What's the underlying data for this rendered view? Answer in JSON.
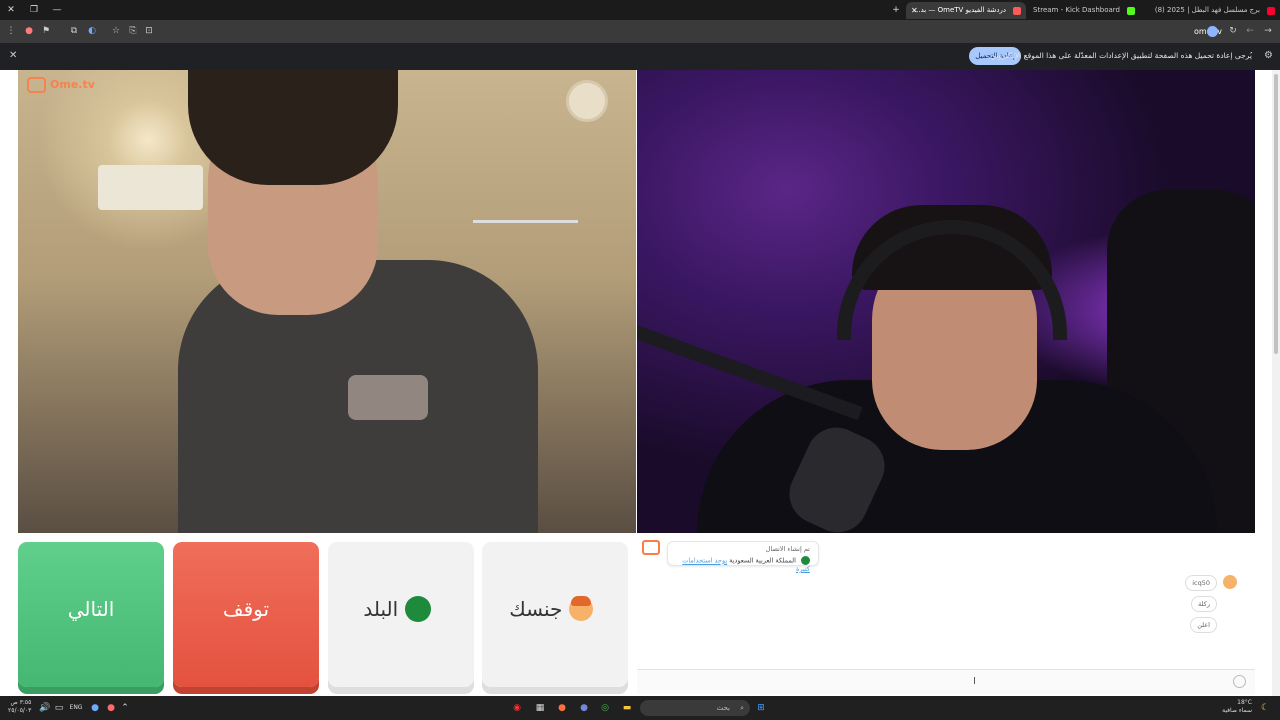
{
  "browser": {
    "tabs": [
      {
        "title": "برج مسلسل فهد البطل | 2025 (8)",
        "favicon_color": "#ff0033"
      },
      {
        "title": "Stream - Kick Dashboard",
        "favicon_color": "#53fc18"
      },
      {
        "title": "دردشة الفيديو OmeTV — بد...",
        "favicon_color": "#ff5a5a"
      }
    ],
    "new_tab": "+",
    "url": "ome.tv"
  },
  "infobar": {
    "message": "يُرجى إعادة تحميل هذه الصفحة لتطبيق الإعدادات المعدّلة على هذا الموقع الإلكتروني.",
    "reload_label": "إعادة التحميل"
  },
  "video": {
    "logo": "Ome.tv"
  },
  "controls": {
    "next_label": "التالي",
    "stop_label": "توقف",
    "country_label": "البلد",
    "gender_label": "جنسك"
  },
  "chat": {
    "system_line1": "تم إنشاء الاتصال",
    "system_link": "يوجد استخدامات كثيرة",
    "system_line2": "المملكة العربية السعودية",
    "messages": [
      "icq50",
      "ركلة",
      "اعلن"
    ]
  },
  "taskbar": {
    "search_placeholder": "بحث",
    "language": "ENG",
    "time": "٣:٥٥ ص",
    "date": "٢٥/٠٥/٠٣",
    "weather_temp": "18°C",
    "weather_desc": "سماء صافية"
  },
  "colors": {
    "next": "#52c47f",
    "stop": "#e95e4a",
    "accent": "#ff7a45"
  }
}
